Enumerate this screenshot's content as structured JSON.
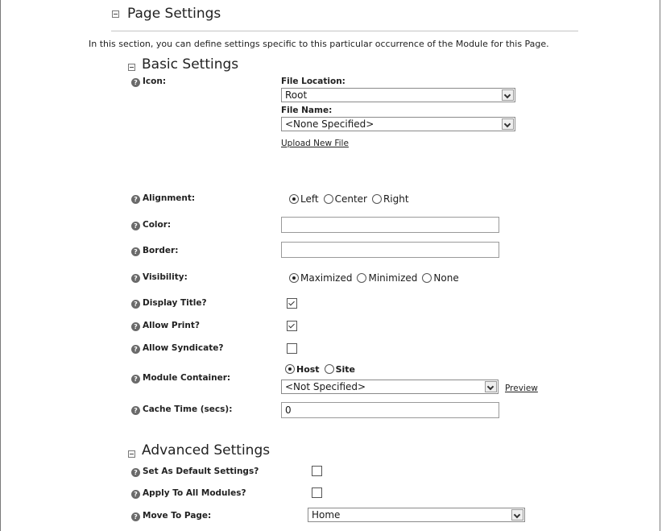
{
  "page_settings": {
    "title": "Page Settings",
    "description": "In this section, you can define settings specific to this particular occurrence of the Module for this Page."
  },
  "basic": {
    "title": "Basic Settings",
    "icon": {
      "label": "Icon:",
      "file_location_label": "File Location:",
      "file_location_value": "Root",
      "file_name_label": "File Name:",
      "file_name_value": "<None Specified>",
      "upload_link": "Upload New File"
    },
    "alignment": {
      "label": "Alignment:",
      "options": [
        "Left",
        "Center",
        "Right"
      ],
      "selected": "Left"
    },
    "color": {
      "label": "Color:",
      "value": ""
    },
    "border": {
      "label": "Border:",
      "value": ""
    },
    "visibility": {
      "label": "Visibility:",
      "options": [
        "Maximized",
        "Minimized",
        "None"
      ],
      "selected": "Maximized"
    },
    "display_title": {
      "label": "Display Title?",
      "checked": true
    },
    "allow_print": {
      "label": "Allow Print?",
      "checked": true
    },
    "allow_syndicate": {
      "label": "Allow Syndicate?",
      "checked": false
    },
    "module_container": {
      "label": "Module Container:",
      "options": [
        "Host",
        "Site"
      ],
      "selected": "Host",
      "value": "<Not Specified>",
      "preview_link": "Preview"
    },
    "cache_time": {
      "label": "Cache Time (secs):",
      "value": "0"
    }
  },
  "advanced": {
    "title": "Advanced Settings",
    "set_default": {
      "label": "Set As Default Settings?",
      "checked": false
    },
    "apply_all": {
      "label": "Apply To All Modules?",
      "checked": false
    },
    "move_to_page": {
      "label": "Move To Page:",
      "value": "Home"
    }
  },
  "icons": {
    "help": "help-icon",
    "collapse": "collapse-minus-icon",
    "dropdown": "chevron-down-icon"
  }
}
